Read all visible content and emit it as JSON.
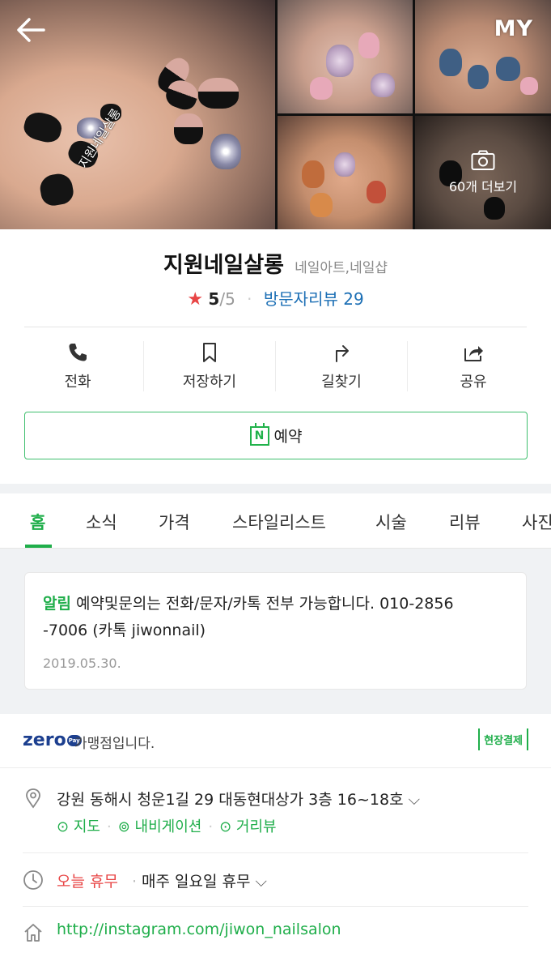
{
  "header": {
    "my_label": "MY",
    "more_photos_label": "60개 더보기",
    "watermark": "지원네일살롱"
  },
  "place": {
    "name": "지원네일살롱",
    "category": "네일아트,네일샵",
    "rating_score": "5",
    "rating_max": "/5",
    "review_label": "방문자리뷰 29"
  },
  "actions": [
    {
      "label": "전화",
      "icon": "phone-icon"
    },
    {
      "label": "저장하기",
      "icon": "bookmark-icon"
    },
    {
      "label": "길찾기",
      "icon": "directions-icon"
    },
    {
      "label": "공유",
      "icon": "share-icon"
    }
  ],
  "reserve": {
    "badge": "N",
    "label": "예약"
  },
  "tabs": [
    "홈",
    "소식",
    "가격",
    "스타일리스트",
    "시술",
    "리뷰",
    "사진"
  ],
  "active_tab": 0,
  "notice": {
    "tag": "알림",
    "text": "예약및문의는 전화/문자/카톡 전부 가능합니다. 010-2856-7006 (카톡 jiwonnail)",
    "line1": "예약및문의는 전화/문자/카톡 전부 가능합니다. 010-2856",
    "line2": "-7006 (카톡 jiwonnail)",
    "date": "2019.05.30."
  },
  "zero_pay": {
    "logo": "zero",
    "pay": "Pay",
    "text": "가맹점입니다.",
    "onsite_label": "현장결제"
  },
  "address": {
    "text": "강원 동해시 청운1길 29 대동현대상가 3층 16~18호",
    "map_label": "지도",
    "nav_label": "내비게이션",
    "street_label": "거리뷰"
  },
  "hours": {
    "status": "오늘 휴무",
    "detail": "매주 일요일 휴무"
  },
  "website": {
    "url": "http://instagram.com/jiwon_nailsalon"
  },
  "colors": {
    "accent_green": "#1fae4a",
    "link_blue": "#1c6fb5",
    "star_red": "#e84545"
  }
}
